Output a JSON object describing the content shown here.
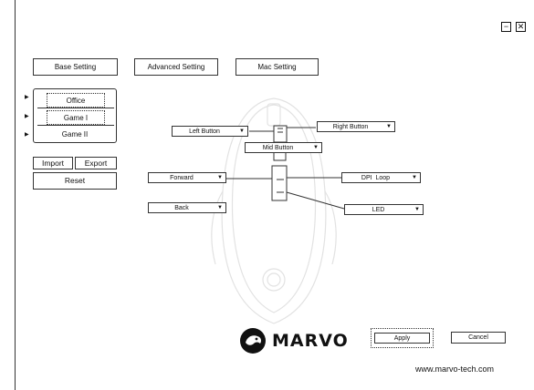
{
  "window": {
    "minimize_glyph": "−",
    "close_glyph": "✕"
  },
  "tabs": [
    {
      "label": "Base Setting"
    },
    {
      "label": "Advanced Setting"
    },
    {
      "label": "Mac Setting"
    }
  ],
  "profiles": {
    "items": [
      "Office",
      "Game I",
      "Game II"
    ],
    "selected": "Office"
  },
  "actions": {
    "import_label": "Import",
    "export_label": "Export",
    "reset_label": "Reset"
  },
  "mapping": {
    "left_button": "Left Button",
    "right_button": "Right Button",
    "mid_button": "Mid Button",
    "forward": "Forward",
    "dpi_loop": "DPI  Loop",
    "back": "Back",
    "led": "LED"
  },
  "footer": {
    "apply_label": "Apply",
    "cancel_label": "Cancel",
    "brand": "MARVO",
    "url": "www.marvo-tech.com"
  },
  "icons": [
    "minimize-icon",
    "close-icon",
    "dropdown-caret-icon",
    "profile-arrow-icon",
    "marvo-logo-icon"
  ]
}
